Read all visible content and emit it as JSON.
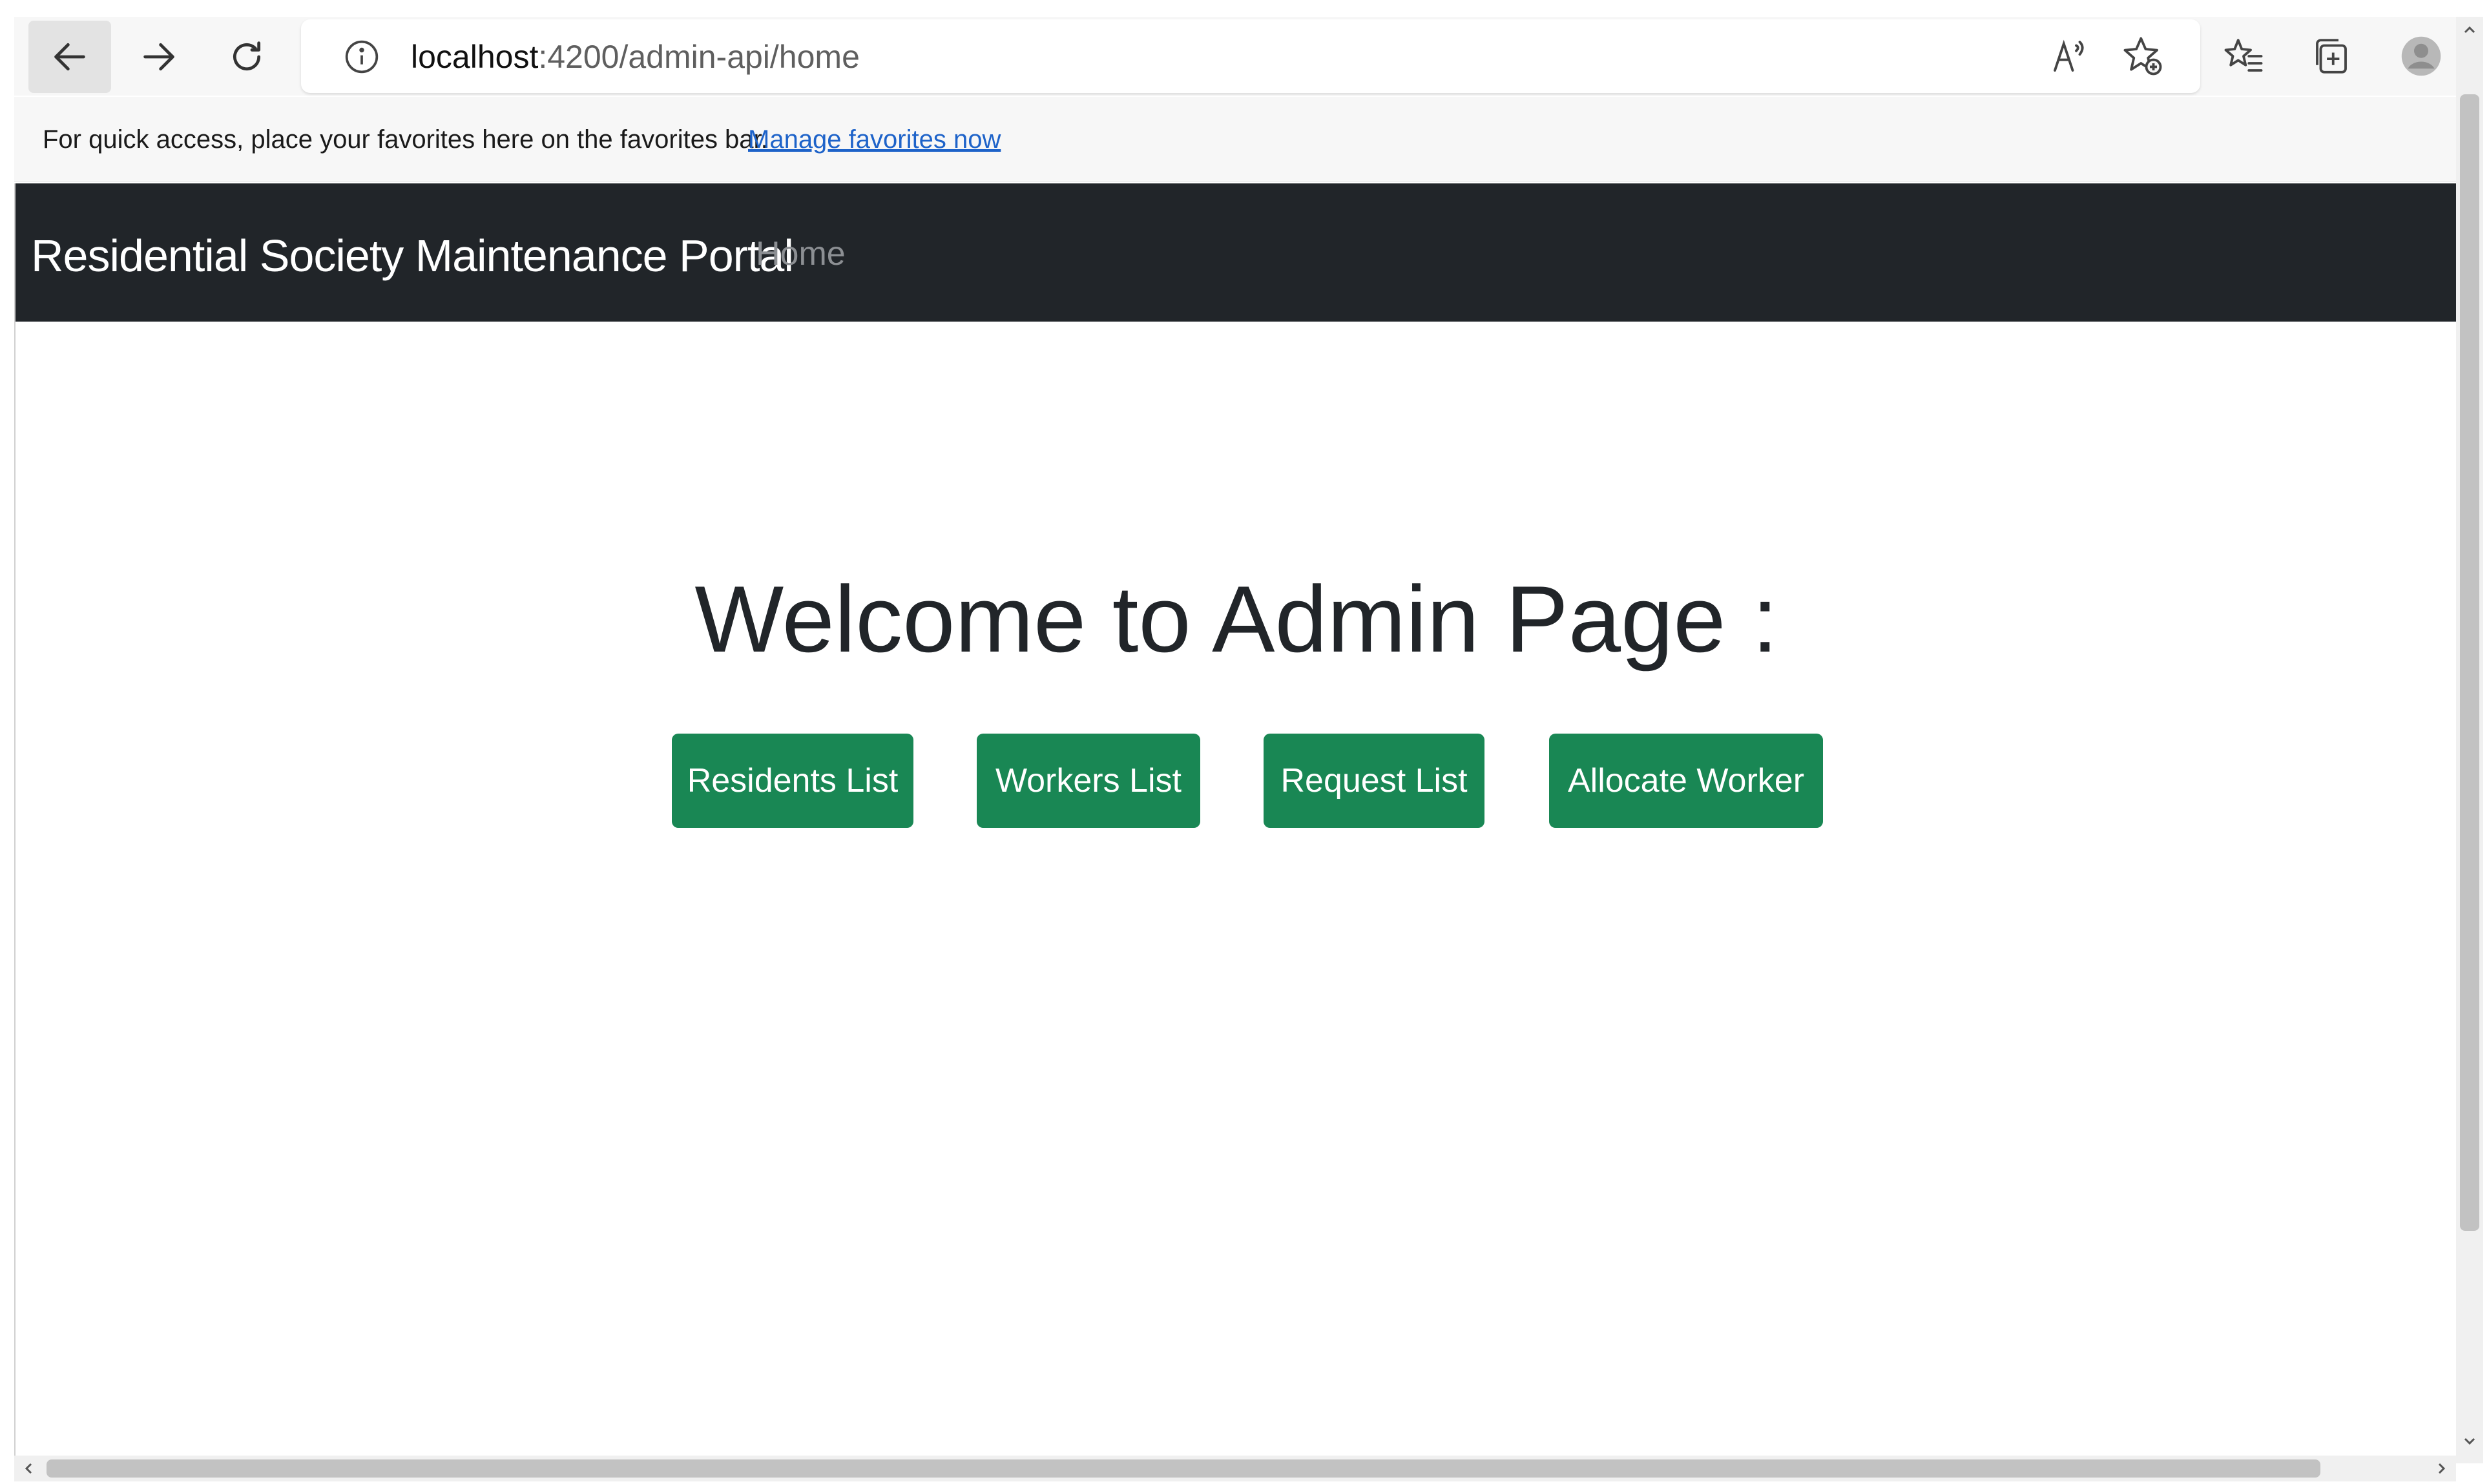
{
  "browser": {
    "address_bar": {
      "url_host": "localhost",
      "url_rest": ":4200/admin-api/home"
    },
    "icons": {
      "back": "back-arrow-icon",
      "forward": "forward-arrow-icon",
      "reload": "reload-icon",
      "site_info": "info-icon",
      "read_aloud": "read-aloud-icon",
      "add_favorite": "add-favorite-icon",
      "favorites": "favorites-icon",
      "collections": "collections-icon",
      "profile": "profile-avatar-icon"
    },
    "favorites_bar": {
      "message": "For quick access, place your favorites here on the favorites bar.",
      "link": "Manage favorites now"
    }
  },
  "page": {
    "navbar": {
      "brand": "Residential Society Maintenance Portal",
      "home_link": "Home"
    },
    "heading": "Welcome to Admin Page :",
    "buttons": {
      "residents": "Residents List",
      "workers": "Workers List",
      "requests": "Request List",
      "allocate": "Allocate Worker"
    }
  },
  "colors": {
    "navbar_bg": "#212529",
    "button_green": "#198754",
    "link_blue": "#1e63c9",
    "nav_muted": "#8c8f93"
  }
}
